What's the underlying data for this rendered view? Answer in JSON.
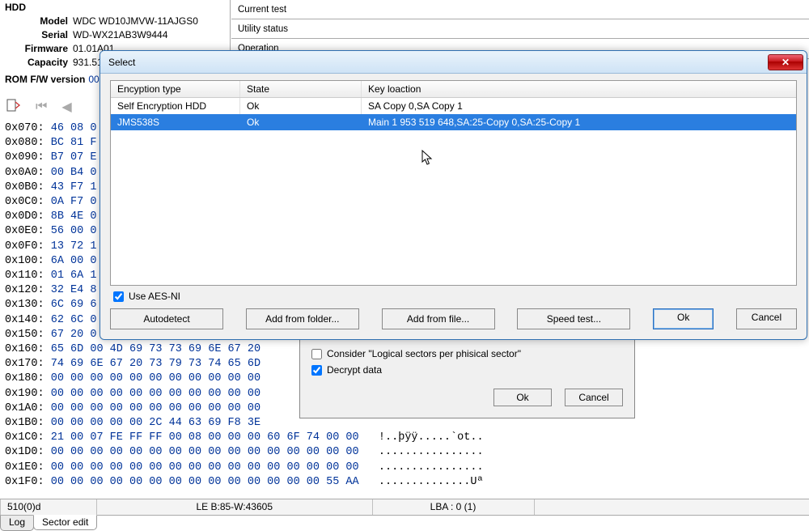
{
  "hdd": {
    "title": "HDD",
    "model_label": "Model",
    "model_value": "WDC WD10JMVW-11AJGS0",
    "serial_label": "Serial",
    "serial_value": "WD-WX21AB3W9444",
    "firmware_label": "Firmware",
    "firmware_value": "01.01A01",
    "capacity_label": "Capacity",
    "capacity_value": "931.51",
    "rom_label": "ROM F/W version",
    "rom_value": "00"
  },
  "status": {
    "current_test": "Current test",
    "utility_status": "Utility status",
    "operation": "Operation"
  },
  "hex": {
    "rows": [
      {
        "addr": "0x070:",
        "bytes": "46 08 0",
        "ascii": ""
      },
      {
        "addr": "0x080:",
        "bytes": "BC 81 F",
        "ascii": ""
      },
      {
        "addr": "0x090:",
        "bytes": "B7 07 E",
        "ascii": ""
      },
      {
        "addr": "0x0A0:",
        "bytes": "00 B4 0",
        "ascii": ""
      },
      {
        "addr": "0x0B0:",
        "bytes": "43 F7 1",
        "ascii": ""
      },
      {
        "addr": "0x0C0:",
        "bytes": "0A F7 0",
        "ascii": ""
      },
      {
        "addr": "0x0D0:",
        "bytes": "8B 4E 0",
        "ascii": ""
      },
      {
        "addr": "0x0E0:",
        "bytes": "56 00 0",
        "ascii": ""
      },
      {
        "addr": "0x0F0:",
        "bytes": "13 72 1",
        "ascii": ""
      },
      {
        "addr": "0x100:",
        "bytes": "6A 00 0",
        "ascii": ""
      },
      {
        "addr": "0x110:",
        "bytes": "01 6A 1",
        "ascii": ""
      },
      {
        "addr": "0x120:",
        "bytes": "32 E4 8",
        "ascii": ""
      },
      {
        "addr": "0x130:",
        "bytes": "6C 69 6",
        "ascii": ""
      },
      {
        "addr": "0x140:",
        "bytes": "62 6C 0",
        "ascii": ""
      },
      {
        "addr": "0x150:",
        "bytes": "67 20 0",
        "ascii": ""
      },
      {
        "addr": "0x160:",
        "bytes": "65 6D 00 4D 69 73 73 69 6E 67 20",
        "ascii": ""
      },
      {
        "addr": "0x170:",
        "bytes": "74 69 6E 67 20 73 79 73 74 65 6D",
        "ascii": ""
      },
      {
        "addr": "0x180:",
        "bytes": "00 00 00 00 00 00 00 00 00 00 00",
        "ascii": ""
      },
      {
        "addr": "0x190:",
        "bytes": "00 00 00 00 00 00 00 00 00 00 00",
        "ascii": ""
      },
      {
        "addr": "0x1A0:",
        "bytes": "00 00 00 00 00 00 00 00 00 00 00",
        "ascii": ""
      },
      {
        "addr": "0x1B0:",
        "bytes": "00 00 00 00 00 2C 44 63 69 F8 3E",
        "ascii": ""
      },
      {
        "addr": "0x1C0:",
        "bytes": "21 00 07 FE FF FF 00 08 00 00 00 60 6F 74 00 00",
        "ascii": "!..þÿÿ.....`ot.."
      },
      {
        "addr": "0x1D0:",
        "bytes": "00 00 00 00 00 00 00 00 00 00 00 00 00 00 00 00",
        "ascii": "................"
      },
      {
        "addr": "0x1E0:",
        "bytes": "00 00 00 00 00 00 00 00 00 00 00 00 00 00 00 00",
        "ascii": "................"
      },
      {
        "addr": "0x1F0:",
        "bytes": "00 00 00 00 00 00 00 00 00 00 00 00 00 00 55 AA",
        "ascii": "..............Uª"
      }
    ]
  },
  "statusbar": {
    "left": "510(0)d",
    "mid": "LE B:85-W:43605",
    "lba": "LBA : 0 (1)"
  },
  "tabs": {
    "log": "Log",
    "sector": "Sector edit"
  },
  "dialog": {
    "title": "Select",
    "headers": {
      "c1": "Encyption type",
      "c2": "State",
      "c3": "Key loaction"
    },
    "rows": [
      {
        "c1": "Self Encryption HDD",
        "c2": "Ok",
        "c3": "SA Copy 0,SA Copy 1",
        "sel": false
      },
      {
        "c1": "JMS538S",
        "c2": "Ok",
        "c3": "Main 1 953 519 648,SA:25-Copy 0,SA:25-Copy 1",
        "sel": true
      }
    ],
    "use_aesni": "Use AES-NI",
    "buttons": {
      "autodetect": "Autodetect",
      "add_folder": "Add from folder...",
      "add_file": "Add from file...",
      "speed": "Speed test...",
      "ok": "Ok",
      "cancel": "Cancel"
    }
  },
  "under": {
    "chk1": "Consider \"Logical sectors per phisical sector\"",
    "chk2": "Decrypt data",
    "ok": "Ok",
    "cancel": "Cancel"
  }
}
